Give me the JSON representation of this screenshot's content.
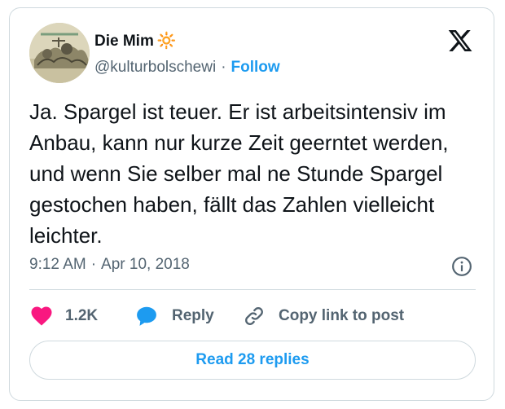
{
  "author": {
    "name": "Die Mim",
    "name_emoji": "🔆",
    "handle": "@kulturbolschewi",
    "separator": "·",
    "follow_label": "Follow"
  },
  "tweet": {
    "text": "Ja. Spargel ist teuer. Er ist arbeitsintensiv im Anbau, kann nur kurze Zeit geerntet werden, und wenn Sie selber mal ne Stunde Spargel gestochen haben, fällt das Zahlen vielleicht leichter.",
    "time": "9:12 AM",
    "separator": "·",
    "date": "Apr 10, 2018"
  },
  "actions": {
    "like_count": "1.2K",
    "reply_label": "Reply",
    "copy_link_label": "Copy link to post"
  },
  "read_replies_label": "Read 28 replies",
  "icons": {
    "brand": "x-logo-icon",
    "info": "info-icon",
    "like": "heart-icon",
    "reply": "speech-bubble-icon",
    "copy": "link-icon"
  },
  "colors": {
    "accent": "#1d9bf0",
    "like": "#f91880",
    "text": "#0f1419",
    "secondary": "#536471",
    "border": "#cfd9de"
  }
}
